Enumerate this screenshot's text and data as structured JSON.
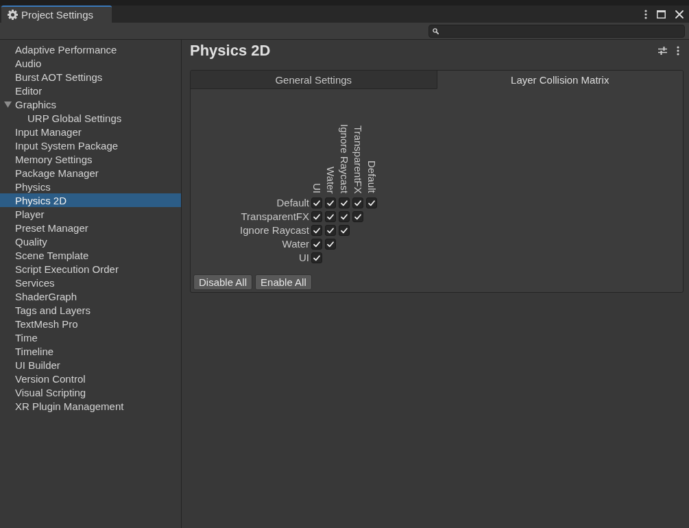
{
  "window": {
    "tab_title": "Project Settings"
  },
  "sidebar": {
    "items": [
      {
        "label": "Adaptive Performance",
        "selected": false
      },
      {
        "label": "Audio",
        "selected": false
      },
      {
        "label": "Burst AOT Settings",
        "selected": false
      },
      {
        "label": "Editor",
        "selected": false
      },
      {
        "label": "Graphics",
        "selected": false,
        "expanded": true,
        "children": [
          {
            "label": "URP Global Settings",
            "selected": false
          }
        ]
      },
      {
        "label": "Input Manager",
        "selected": false
      },
      {
        "label": "Input System Package",
        "selected": false
      },
      {
        "label": "Memory Settings",
        "selected": false
      },
      {
        "label": "Package Manager",
        "selected": false
      },
      {
        "label": "Physics",
        "selected": false
      },
      {
        "label": "Physics 2D",
        "selected": true
      },
      {
        "label": "Player",
        "selected": false
      },
      {
        "label": "Preset Manager",
        "selected": false
      },
      {
        "label": "Quality",
        "selected": false
      },
      {
        "label": "Scene Template",
        "selected": false
      },
      {
        "label": "Script Execution Order",
        "selected": false
      },
      {
        "label": "Services",
        "selected": false
      },
      {
        "label": "ShaderGraph",
        "selected": false
      },
      {
        "label": "Tags and Layers",
        "selected": false
      },
      {
        "label": "TextMesh Pro",
        "selected": false
      },
      {
        "label": "Time",
        "selected": false
      },
      {
        "label": "Timeline",
        "selected": false
      },
      {
        "label": "UI Builder",
        "selected": false
      },
      {
        "label": "Version Control",
        "selected": false
      },
      {
        "label": "Visual Scripting",
        "selected": false
      },
      {
        "label": "XR Plugin Management",
        "selected": false
      }
    ]
  },
  "page": {
    "title": "Physics 2D",
    "tabs": [
      {
        "label": "General Settings",
        "selected": false
      },
      {
        "label": "Layer Collision Matrix",
        "selected": true
      }
    ],
    "matrix": {
      "columns": [
        "UI",
        "Water",
        "Ignore Raycast",
        "TransparentFX",
        "Default"
      ],
      "rows": [
        {
          "label": "Default",
          "cells": [
            {
              "checked": true
            },
            {
              "checked": true
            },
            {
              "checked": true
            },
            {
              "checked": true
            },
            {
              "checked": true
            }
          ]
        },
        {
          "label": "TransparentFX",
          "cells": [
            {
              "checked": true
            },
            {
              "checked": true
            },
            {
              "checked": true
            },
            {
              "checked": true
            }
          ]
        },
        {
          "label": "Ignore Raycast",
          "cells": [
            {
              "checked": true
            },
            {
              "checked": true
            },
            {
              "checked": true
            }
          ]
        },
        {
          "label": "Water",
          "cells": [
            {
              "checked": true
            },
            {
              "checked": true
            }
          ]
        },
        {
          "label": "UI",
          "cells": [
            {
              "checked": true
            }
          ]
        }
      ]
    },
    "buttons": [
      "Disable All",
      "Enable All"
    ]
  }
}
